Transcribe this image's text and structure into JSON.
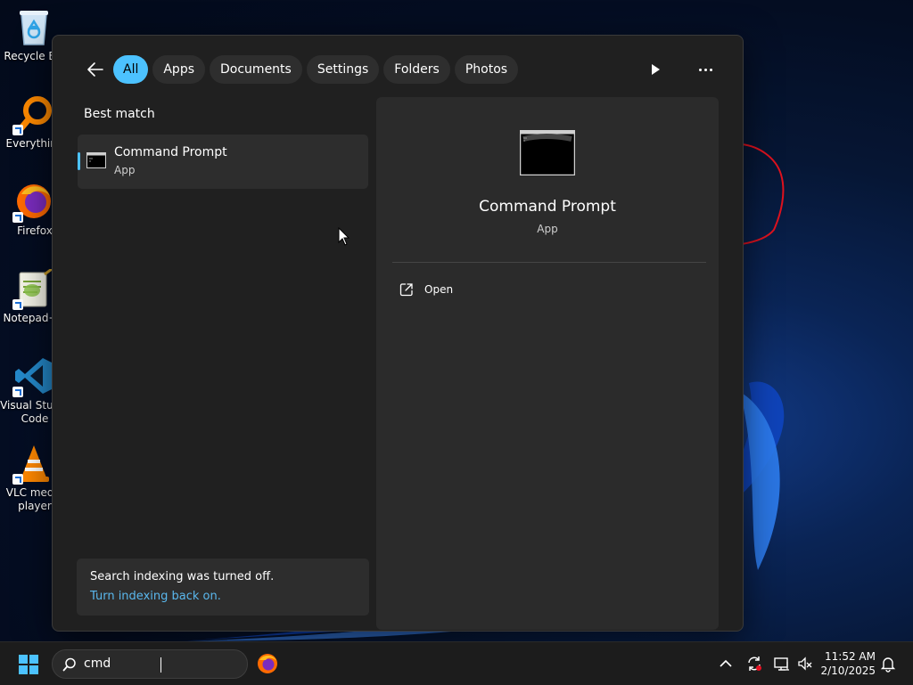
{
  "desktop": {
    "icons": [
      {
        "label": "Recycle Bin",
        "icon": "recycle-bin-icon"
      },
      {
        "label": "Everything",
        "icon": "everything-search-icon"
      },
      {
        "label": "Firefox",
        "icon": "firefox-icon"
      },
      {
        "label": "Notepad++",
        "icon": "notepad-plus-plus-icon"
      },
      {
        "label": "Visual Studio Code",
        "icon": "vscode-icon"
      },
      {
        "label": "VLC media player",
        "icon": "vlc-icon"
      }
    ]
  },
  "search_panel": {
    "tabs": [
      "All",
      "Apps",
      "Documents",
      "Settings",
      "Folders",
      "Photos"
    ],
    "active_tab": "All",
    "best_match_label": "Best match",
    "result": {
      "title": "Command Prompt",
      "subtitle": "App"
    },
    "notice": {
      "text": "Search indexing was turned off.",
      "link": "Turn indexing back on."
    },
    "preview": {
      "title": "Command Prompt",
      "subtitle": "App",
      "action_open": "Open"
    }
  },
  "taskbar": {
    "search_value": "cmd",
    "time": "11:52 AM",
    "date": "2/10/2025"
  },
  "colors": {
    "accent": "#4cc2ff",
    "link": "#5ab8ee",
    "panel_bg": "#202020"
  }
}
